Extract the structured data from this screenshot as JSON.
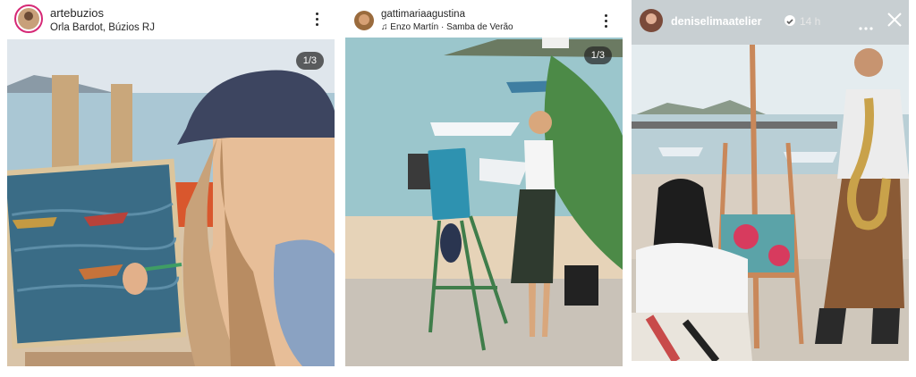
{
  "posts": [
    {
      "username": "artebuzios",
      "location": "Orla Bardot, Búzios RJ",
      "counter": "1/3",
      "more_icon": "more-vertical-icon"
    },
    {
      "username": "gattimariaagustina",
      "music": "Enzo Martín · Samba de Verão",
      "music_icon": "music-note-icon",
      "counter": "1/3",
      "more_icon": "more-vertical-icon"
    }
  ],
  "story": {
    "username": "deniselimaatelier",
    "time": "14 h",
    "verified_icon": "verified-badge-icon",
    "more_icon": "more-horizontal-icon",
    "close_icon": "close-icon"
  },
  "colors": {
    "text": "#262626",
    "story_text": "#ffffff",
    "sea": "#9ec9d4",
    "sand": "#e8d6bf",
    "easel_wood": "#c9885a",
    "easel_green": "#3f7d4a"
  }
}
